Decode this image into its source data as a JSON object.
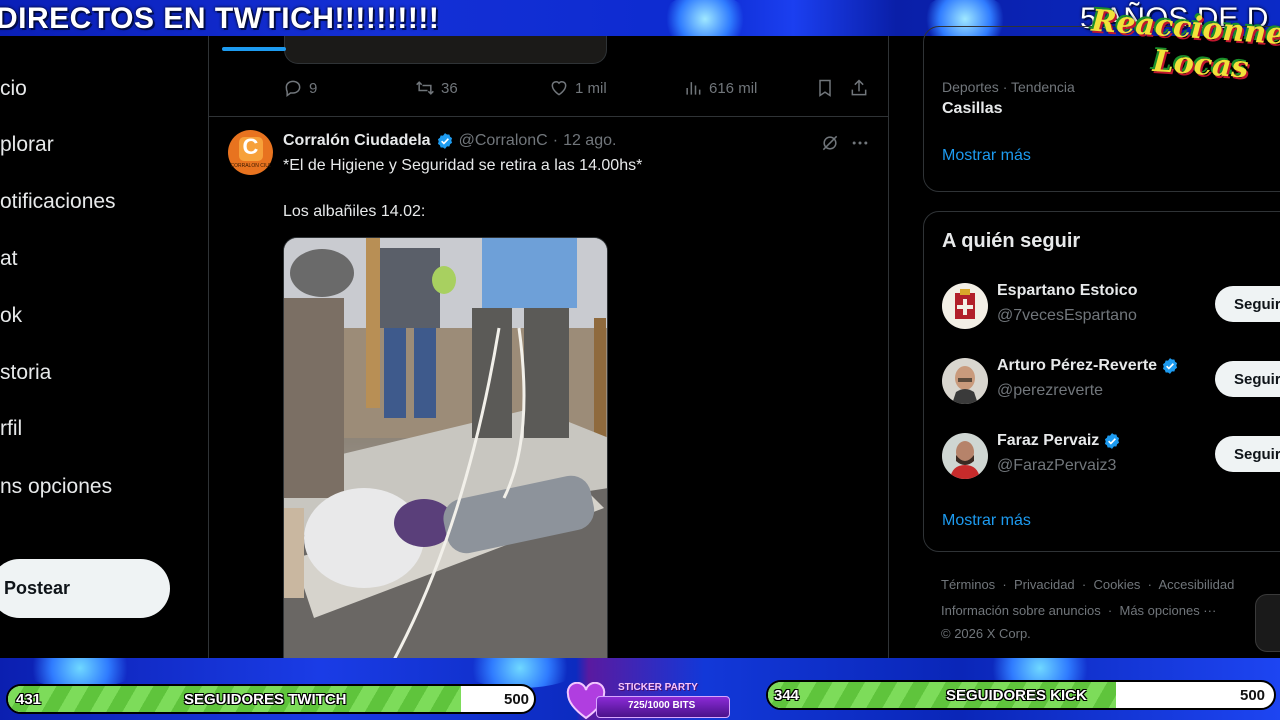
{
  "stream_overlay": {
    "banner_text": "DIRECTOS EN TWTICH!!!!!!!!!!",
    "banner_right_text": "5 AÑOS DE D",
    "logo_line1": "Reaccionnes",
    "logo_line2": "Locas",
    "twitch_goal": {
      "current": "431",
      "label": "SEGUIDORES TWITCH",
      "max": "500",
      "progress": 0.862
    },
    "kick_goal": {
      "current": "344",
      "label": "SEGUIDORES KICK",
      "max": "500",
      "progress": 0.688
    },
    "sticker": {
      "title": "STICKER PARTY",
      "bits": "725/1000 BITS"
    }
  },
  "left_nav": {
    "items": [
      {
        "label": "cio",
        "icon": "home-icon"
      },
      {
        "label": "plorar",
        "icon": "search-icon"
      },
      {
        "label": "otificaciones",
        "icon": "bell-icon"
      },
      {
        "label": "at",
        "icon": "chat-icon"
      },
      {
        "label": "ok",
        "icon": "grok-icon"
      },
      {
        "label": "storia",
        "icon": "history-icon"
      },
      {
        "label": "rfil",
        "icon": "user-icon"
      },
      {
        "label": "ns opciones",
        "icon": "more-icon"
      }
    ],
    "post_button": "Postear"
  },
  "prev_tweet_actions": {
    "replies": "9",
    "reposts": "36",
    "likes": "1 mil",
    "views": "616 mil"
  },
  "tweet": {
    "name": "Corralón Ciudadela",
    "handle": "@CorralonC",
    "dot": "·",
    "time": "12 ago.",
    "text_line1": "*El de Higiene y Seguridad se retira a las 14.00hs*",
    "text_line2": "Los albañiles 14.02:",
    "avatar_text": "C",
    "avatar_subtext": "CORRALÓN CIUDADELA"
  },
  "trends": {
    "category": "Deportes · Tendencia",
    "topic": "Casillas",
    "show_more": "Mostrar más"
  },
  "who_to_follow": {
    "title": "A quién seguir",
    "accounts": [
      {
        "name": "Espartano Estoico",
        "handle": "@7vecesEspartano",
        "button": "Seguir"
      },
      {
        "name": "Arturo Pérez-Reverte",
        "handle": "@perezreverte",
        "button": "Seguir"
      },
      {
        "name": "Faraz Pervaiz",
        "handle": "@FarazPervaiz3",
        "button": "Seguir"
      }
    ],
    "show_more": "Mostrar más"
  },
  "footer": {
    "terms": "Términos",
    "privacy": "Privacidad",
    "cookies": "Cookies",
    "accessibility": "Accesibilidad",
    "ads_info": "Información sobre anuncios",
    "more_options": "Más opciones ···",
    "copyright": "© 2026 X Corp."
  },
  "colors": {
    "accent": "#1d9bf0",
    "background": "#000000",
    "muted_text": "#71767b",
    "overlay_blue": "#1430d6",
    "goal_green": "#7ddc5a"
  }
}
